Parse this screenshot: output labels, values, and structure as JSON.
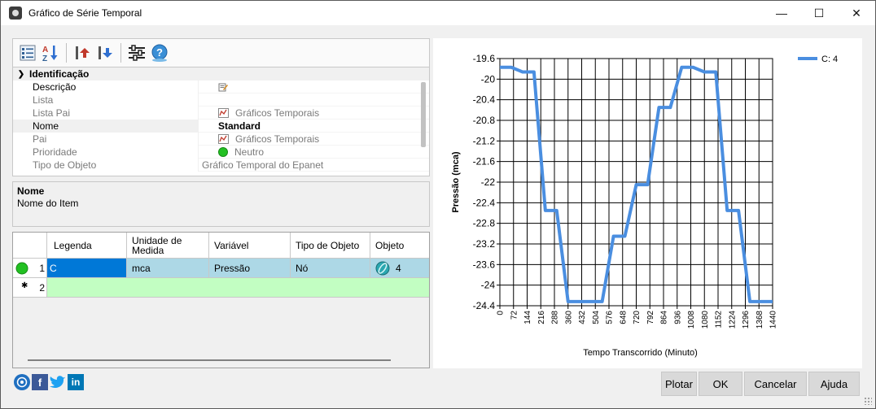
{
  "window": {
    "title": "Gráfico de Série Temporal",
    "minimize_glyph": "—",
    "maximize_glyph": "☐",
    "close_glyph": "✕"
  },
  "toolbar": {
    "buttons": [
      "categorized-icon",
      "sort-az-icon",
      "move-up-icon",
      "move-down-icon",
      "properties-sliders-icon",
      "help-icon"
    ]
  },
  "properties": {
    "category": "Identificação",
    "rows": [
      {
        "name": "Descrição",
        "value": "",
        "editable": true
      },
      {
        "name": "Lista",
        "value": ""
      },
      {
        "name": "Lista Pai",
        "value": "Gráficos Temporais"
      },
      {
        "name": "Nome",
        "value": "Standard"
      },
      {
        "name": "Pai",
        "value": "Gráficos Temporais"
      },
      {
        "name": "Prioridade",
        "value": "Neutro"
      },
      {
        "name": "Tipo de Objeto",
        "value": "Gráfico Temporal do Epanet"
      }
    ]
  },
  "description": {
    "title": "Nome",
    "text": "Nome do Item"
  },
  "grid": {
    "headers": [
      "Legenda",
      "Unidade de Medida",
      "Variável",
      "Tipo de Objeto",
      "Objeto"
    ],
    "rows": [
      {
        "num": "1",
        "legenda": "C",
        "unidade": "mca",
        "variavel": "Pressão",
        "tipo": "Nó",
        "objeto": "4"
      },
      {
        "num": "2",
        "legenda": "",
        "unidade": "",
        "variavel": "",
        "tipo": "",
        "objeto": ""
      }
    ]
  },
  "colors": {
    "series": "#4a8ee0",
    "accent": "#0078d7",
    "row_selected": "#add8e6",
    "row_new": "#c2fec2",
    "status_green": "#22c022"
  },
  "chart_data": {
    "type": "line",
    "xlabel": "Tempo Transcorrido (Minuto)",
    "ylabel": "Pressão (mca)",
    "legend": [
      "C: 4"
    ],
    "legend_position": "top-right",
    "grid": true,
    "ylim": [
      -24.4,
      -19.6
    ],
    "xlim": [
      0,
      1440
    ],
    "x_ticks": [
      "0",
      "72",
      "144",
      "216",
      "288",
      "360",
      "432",
      "504",
      "576",
      "648",
      "720",
      "792",
      "864",
      "936",
      "1008",
      "1080",
      "1152",
      "1224",
      "1296",
      "1368",
      "1440"
    ],
    "y_ticks": [
      "-19.6",
      "-20",
      "-20.4",
      "-20.8",
      "-21.2",
      "-21.6",
      "-22",
      "-22.4",
      "-22.8",
      "-23.2",
      "-23.6",
      "-24",
      "-24.4"
    ],
    "series": [
      {
        "name": "C: 4",
        "x": [
          0,
          60,
          120,
          180,
          240,
          300,
          360,
          420,
          480,
          540,
          600,
          660,
          720,
          780,
          840,
          900,
          960,
          1020,
          1080,
          1140,
          1200,
          1260,
          1320,
          1380,
          1440
        ],
        "y": [
          -19.77,
          -19.77,
          -19.86,
          -19.86,
          -22.55,
          -22.55,
          -24.32,
          -24.32,
          -24.32,
          -24.32,
          -23.05,
          -23.05,
          -22.05,
          -22.05,
          -20.55,
          -20.55,
          -19.77,
          -19.77,
          -19.86,
          -19.86,
          -22.55,
          -22.55,
          -24.32,
          -24.32,
          -24.32
        ]
      }
    ]
  },
  "buttons": {
    "plot": "Plotar",
    "ok": "OK",
    "cancel": "Cancelar",
    "help": "Ajuda"
  }
}
